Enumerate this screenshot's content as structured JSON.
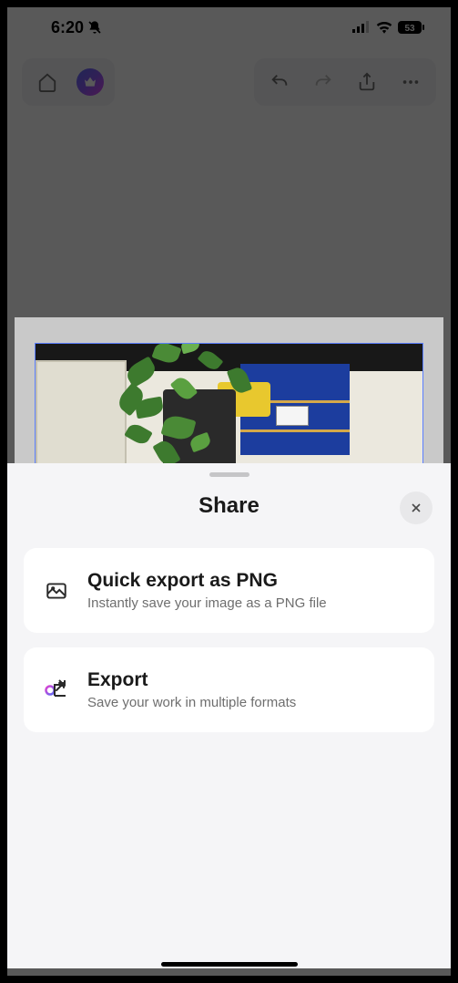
{
  "status_bar": {
    "time": "6:20",
    "battery_level": "53"
  },
  "sheet": {
    "title": "Share",
    "options": [
      {
        "icon": "image-icon",
        "title": "Quick export as PNG",
        "description": "Instantly save your image as a PNG file"
      },
      {
        "icon": "export-icon",
        "title": "Export",
        "description": "Save your work in multiple formats"
      }
    ]
  }
}
